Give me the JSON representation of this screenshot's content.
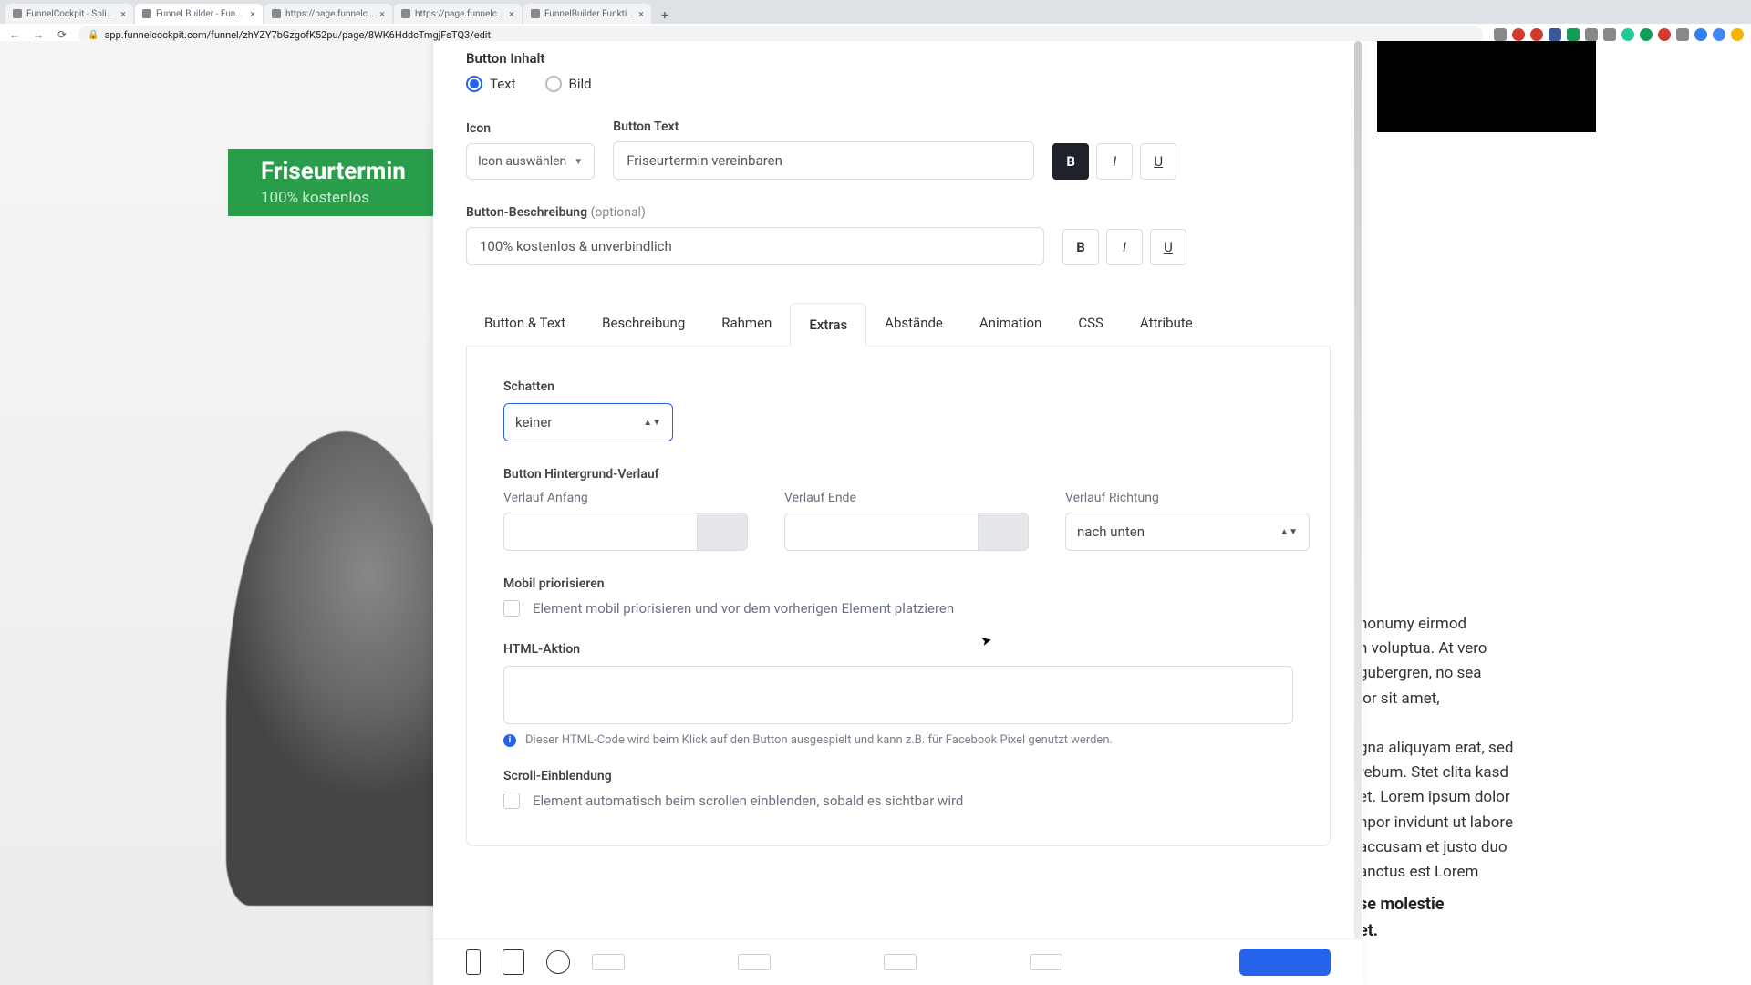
{
  "browser": {
    "tabs": [
      {
        "label": "FunnelCockpit - Splittests, Ma"
      },
      {
        "label": "Funnel Builder - FunnelCockpit"
      },
      {
        "label": "https://page.funnelcockpit.co"
      },
      {
        "label": "https://page.funnelcockpit.co"
      },
      {
        "label": "FunnelBuilder Funktionen & E"
      }
    ],
    "active_tab": 1,
    "url": "app.funnelcockpit.com/funnel/zhYZY7bGzgofK52pu/page/8WK6HddcTmgjFsTQ3/edit",
    "ext_colors": [
      "#888",
      "#d33a2f",
      "#d33a2f",
      "#3b5998",
      "#0f9d58",
      "#888",
      "#888",
      "#20c997",
      "#0f9d58",
      "#d33a2f",
      "#888",
      "#2f80ed",
      "#4285f4",
      "#f4b400"
    ]
  },
  "background": {
    "button_title": "Friseurtermin",
    "button_sub": "100% kostenlos",
    "text_fragment": "nonumy eirmod\nn voluptua. At vero\ngubergren, no sea\nlor sit amet,\n\ngna aliquyam erat, sed\nrebum. Stet clita kasd\net. Lorem ipsum dolor\nnpor invidunt ut labore\naccusam et justo duo\nanctus est Lorem",
    "text_bold": "se molestie\net."
  },
  "panel": {
    "section_label": "Button Inhalt",
    "radio_text": "Text",
    "radio_image": "Bild",
    "icon_label": "Icon",
    "icon_select": "Icon auswählen",
    "button_text_label": "Button Text",
    "button_text_value": "Friseurtermin vereinbaren",
    "desc_label": "Button-Beschreibung",
    "desc_optional": "(optional)",
    "desc_value": "100% kostenlos & unverbindlich",
    "biu": {
      "B": "B",
      "I": "I",
      "U": "U"
    },
    "tabs": [
      "Button & Text",
      "Beschreibung",
      "Rahmen",
      "Extras",
      "Abstände",
      "Animation",
      "CSS",
      "Attribute"
    ],
    "active_tab_index": 3,
    "extras": {
      "shadow_label": "Schatten",
      "shadow_value": "keiner",
      "gradient_label": "Button Hintergrund-Verlauf",
      "grad_start": "Verlauf Anfang",
      "grad_end": "Verlauf Ende",
      "grad_dir_label": "Verlauf Richtung",
      "grad_dir_value": "nach unten",
      "mobile_label": "Mobil priorisieren",
      "mobile_chk": "Element mobil priorisieren und vor dem vorherigen Element platzieren",
      "html_label": "HTML-Aktion",
      "html_info": "Dieser HTML-Code wird beim Klick auf den Button ausgespielt und kann z.B. für Facebook Pixel genutzt werden.",
      "scroll_label": "Scroll-Einblendung",
      "scroll_chk": "Element automatisch beim scrollen einblenden, sobald es sichtbar wird"
    }
  }
}
